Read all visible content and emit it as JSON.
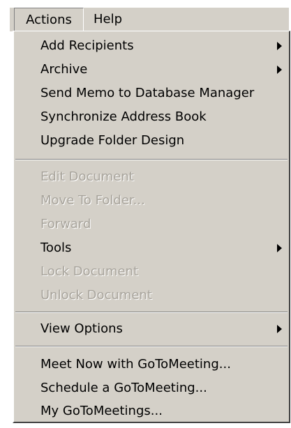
{
  "menubar": {
    "actions_label": "Actions",
    "help_label": "Help"
  },
  "menu": {
    "group1": [
      {
        "label": "Add Recipients",
        "submenu": true,
        "enabled": true
      },
      {
        "label": "Archive",
        "submenu": true,
        "enabled": true
      },
      {
        "label": "Send Memo to Database Manager",
        "submenu": false,
        "enabled": true
      },
      {
        "label": "Synchronize Address Book",
        "submenu": false,
        "enabled": true
      },
      {
        "label": "Upgrade Folder Design",
        "submenu": false,
        "enabled": true
      }
    ],
    "group2": [
      {
        "label": "Edit Document",
        "submenu": false,
        "enabled": false
      },
      {
        "label": "Move To Folder...",
        "submenu": false,
        "enabled": false
      },
      {
        "label": "Forward",
        "submenu": false,
        "enabled": false
      },
      {
        "label": "Tools",
        "submenu": true,
        "enabled": true
      },
      {
        "label": "Lock Document",
        "submenu": false,
        "enabled": false
      },
      {
        "label": "Unlock Document",
        "submenu": false,
        "enabled": false
      }
    ],
    "group3": [
      {
        "label": "View Options",
        "submenu": true,
        "enabled": true
      }
    ],
    "group4": [
      {
        "label": "Meet Now with GoToMeeting...",
        "submenu": false,
        "enabled": true
      },
      {
        "label": "Schedule a GoToMeeting...",
        "submenu": false,
        "enabled": true
      },
      {
        "label": "My GoToMeetings...",
        "submenu": false,
        "enabled": true
      }
    ]
  },
  "colors": {
    "menu_background": "#d4d0c8",
    "disabled_text": "#a8a49c",
    "text": "#000000"
  },
  "icons": {
    "submenu_arrow": "chevron-right-icon"
  }
}
